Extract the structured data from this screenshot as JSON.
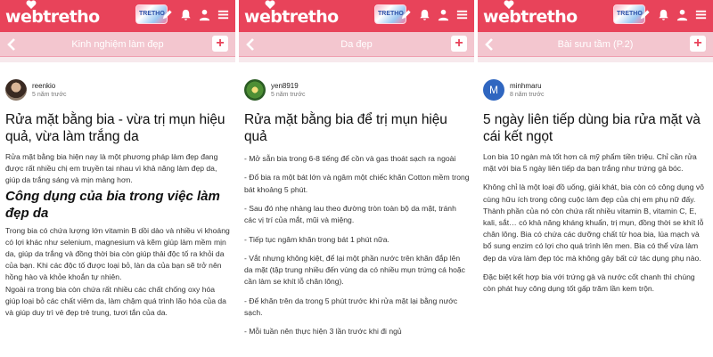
{
  "brand": {
    "logo_text": "webtretho",
    "brand_color": "#e8435a",
    "sub_bar_color": "#f3c6cf"
  },
  "header_icons": [
    "pencil-icon",
    "bell-icon",
    "user-icon",
    "menu-icon"
  ],
  "panels": [
    {
      "sub_title": "Kinh nghiệm làm đẹp",
      "author": "reenkio",
      "time": "5 năm trước",
      "title": "Rửa mặt bằng bia - vừa trị mụn hiệu quả, vừa làm trắng da",
      "intro": "Rửa mặt bằng bia hiện nay là một phương pháp làm đẹp đang được rất nhiều chị em truyền tai nhau vì khả năng làm đẹp da, giúp da trắng sáng và mịn màng hơn.",
      "heading": "Công dụng của bia trong việc làm đẹp da",
      "para1": "Trong bia có chứa lượng lớn vitamin B dồi dào và nhiều vi khoáng có lợi khác như selenium, magnesium và kẽm giúp làm mềm mịn da, giúp da trắng và đồng thời bia còn giúp thải độc tố ra khỏi da của bạn. Khi các độc tố được loại bỏ, làn da của bạn sẽ trở nên hồng hào và khỏe khoắn tự nhiên.",
      "para2": "Ngoài ra trong bia còn chứa rất nhiều các chất chống oxy hóa giúp loại bỏ các chất viêm da, làm chậm quá trình lão hóa của da và giúp duy trì vẻ đẹp trẻ trung, tươi tắn của da."
    },
    {
      "sub_title": "Da đẹp",
      "author": "yen8919",
      "time": "5 năm trước",
      "title": "Rửa mặt bằng bia để trị mụn hiệu quả",
      "steps": [
        "- Mở sẵn bia trong 6-8 tiếng để cồn và gas thoát sạch ra ngoài",
        "- Đổ bia ra một bát lớn và ngâm một chiếc khăn Cotton mềm trong bát khoảng 5 phút.",
        "- Sau đó nhẹ nhàng lau theo đường tròn toàn bộ da mặt, tránh các vị trí của mắt, mũi và miệng.",
        "- Tiếp tục ngâm khăn trong bát 1 phút nữa.",
        "- Vắt nhưng không kiệt, để lại một phần nước trên khăn đắp lên da mặt (tập trung nhiều đến vùng da có nhiều mụn trứng cá hoặc cần làm se khít lỗ chân lông).",
        "- Để khăn trên da trong 5 phút trước khi rửa mặt lại bằng nước sạch.",
        "- Mỗi tuần nên thực hiện 3 lần trước khi đi ngủ"
      ]
    },
    {
      "sub_title": "Bài sưu tầm (P.2)",
      "author": "minhmaru",
      "avatar_letter": "M",
      "time": "8 năm trước",
      "title": "5 ngày liên tiếp dùng bia rửa mặt và cái kết ngọt",
      "intro": "Lon bia 10 ngàn mà tốt hơn cả mỹ phẩm tiền triệu. Chỉ cần rửa mặt với bia 5 ngày liên tiếp da bạn trắng như trứng gà bóc.",
      "para1": "Không chỉ là một loại đồ uống, giải khát, bia còn có công dụng vô cùng hữu ích trong công cuộc làm đẹp của chị em phụ nữ đấy. Thành phần của nó còn chứa rất nhiều vitamin B, vitamin C, E, kali, sắt… có khả năng kháng khuẩn, trị mụn, đồng thời se khít lỗ chân lông. Bia có chứa các dưỡng chất từ hoa bia, lúa mạch và bổ sung enzim có lợi cho quá trình lên men. Bia có thể vừa làm đẹp da vừa làm đẹp tóc mà không gây bất cứ tác dụng phụ nào.",
      "para2": "Đặc biệt kết hợp bia với trứng gà và nước cốt chanh thì chúng còn phát huy công dụng tốt gấp trăm lần kem trộn."
    }
  ]
}
